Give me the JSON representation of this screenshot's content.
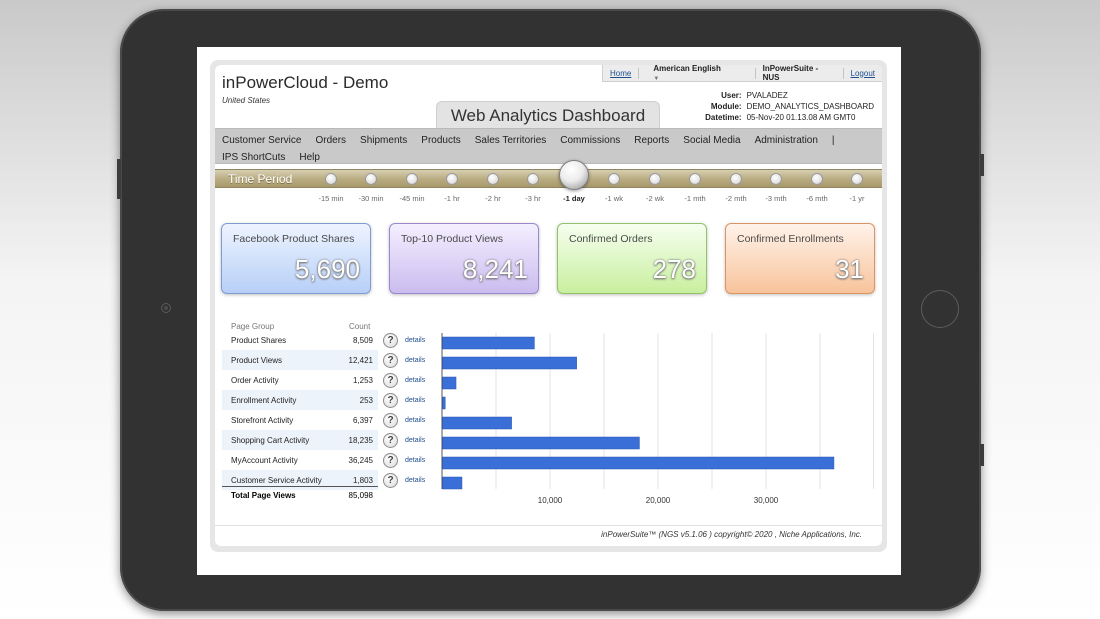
{
  "header": {
    "company": "inPowerCloud - Demo",
    "country": "United States",
    "dashboard_title": "Web Analytics Dashboard",
    "links": {
      "home": "Home",
      "language": "American English",
      "suite": "InPowerSuite - NUS",
      "logout": "Logout"
    },
    "user_info": {
      "user_label": "User:",
      "user": "PVALADEZ",
      "module_label": "Module:",
      "module": "DEMO_ANALYTICS_DASHBOARD",
      "datetime_label": "Datetime:",
      "datetime": "05-Nov-20 01.13.08 AM GMT0"
    }
  },
  "nav": {
    "items": [
      "Customer Service",
      "Orders",
      "Shipments",
      "Products",
      "Sales Territories",
      "Commissions",
      "Reports",
      "Social Media",
      "Administration",
      "|"
    ],
    "row2": [
      "IPS ShortCuts",
      "Help"
    ]
  },
  "time_period": {
    "label": "Time Period",
    "options": [
      "-15 min",
      "-30 min",
      "-45 min",
      "-1 hr",
      "-2 hr",
      "-3 hr",
      "-1 day",
      "-1 wk",
      "-2 wk",
      "-1 mth",
      "-2 mth",
      "-3 mth",
      "-6 mth",
      "-1 yr"
    ],
    "selected": "-1 day"
  },
  "cards": [
    {
      "title": "Facebook Product Shares",
      "value": "5,690"
    },
    {
      "title": "Top-10 Product Views",
      "value": "8,241"
    },
    {
      "title": "Confirmed Orders",
      "value": "278"
    },
    {
      "title": "Confirmed Enrollments",
      "value": "31"
    }
  ],
  "table": {
    "headers": {
      "group": "Page Group",
      "count": "Count"
    },
    "rows": [
      {
        "group": "Product Shares",
        "count": "8,509"
      },
      {
        "group": "Product Views",
        "count": "12,421"
      },
      {
        "group": "Order Activity",
        "count": "1,253"
      },
      {
        "group": "Enrollment Activity",
        "count": "253"
      },
      {
        "group": "Storefront Activity",
        "count": "6,397"
      },
      {
        "group": "Shopping Cart Activity",
        "count": "18,235"
      },
      {
        "group": "MyAccount Activity",
        "count": "36,245"
      },
      {
        "group": "Customer Service Activity",
        "count": "1,803"
      }
    ],
    "help_glyph": "?",
    "details_label": "details",
    "total": {
      "label": "Total Page Views",
      "count": "85,098"
    }
  },
  "chart_data": {
    "type": "bar",
    "orientation": "horizontal",
    "categories": [
      "Product Shares",
      "Product Views",
      "Order Activity",
      "Enrollment Activity",
      "Storefront Activity",
      "Shopping Cart Activity",
      "MyAccount Activity",
      "Customer Service Activity"
    ],
    "values": [
      8509,
      12421,
      1253,
      253,
      6397,
      18235,
      36245,
      1803
    ],
    "xticks": [
      10000,
      20000,
      30000
    ],
    "xtick_labels": [
      "10,000",
      "20,000",
      "30,000"
    ],
    "xlim": [
      0,
      40000
    ],
    "grid": true,
    "bar_color": "#3b6fd8"
  },
  "footer": "inPowerSuite™ (NGS v5.1.06 ) copyright© 2020 , Niche Applications, Inc."
}
